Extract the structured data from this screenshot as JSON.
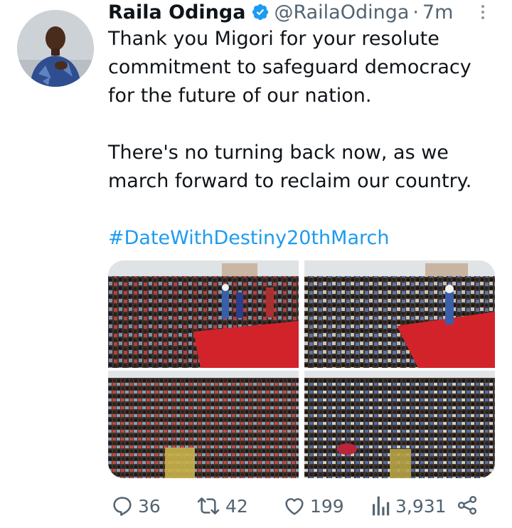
{
  "tweet": {
    "author_name": "Raila Odinga",
    "handle": "@RailaOdinga",
    "separator": "·",
    "time": "7m",
    "verified_icon": "verified-badge-icon",
    "text_line1": "Thank you Migori for your resolute commitment to safeguard democracy for the future of our nation.",
    "text_line2": "There's no turning back now, as we march forward to reclaim our country.",
    "hashtag": "#DateWithDestiny20thMarch",
    "photos": [
      {
        "icon": "rally-photo-1"
      },
      {
        "icon": "rally-photo-2"
      },
      {
        "icon": "rally-photo-3"
      },
      {
        "icon": "rally-photo-4"
      }
    ]
  },
  "actions": {
    "replies": "36",
    "retweets": "42",
    "likes": "199",
    "views": "3,931"
  },
  "colors": {
    "accent": "#1d9bf0",
    "secondary_text": "#536471",
    "stage_red": "#d2232a"
  }
}
